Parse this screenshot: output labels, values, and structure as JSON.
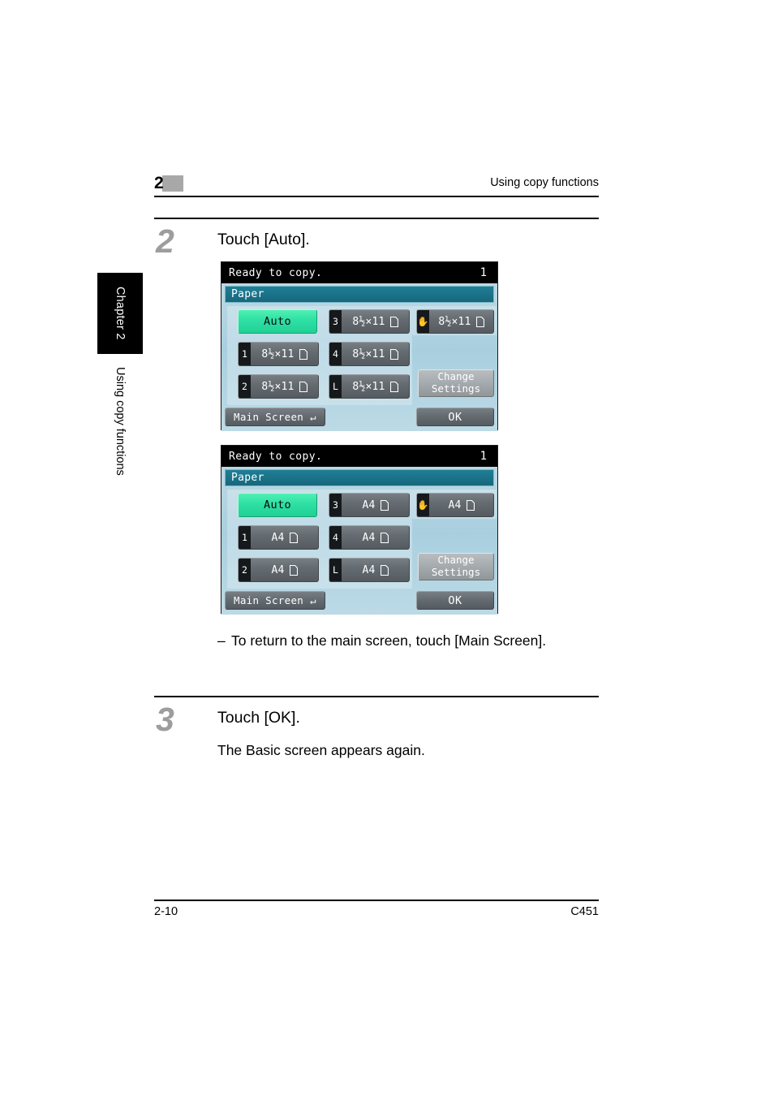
{
  "header": {
    "chapter_number": "2",
    "title": "Using copy functions"
  },
  "sidebar": {
    "tab_label": "Chapter 2",
    "vertical_label": "Using copy functions"
  },
  "steps": [
    {
      "number": "2",
      "title": "Touch [Auto].",
      "note_dash": "–",
      "note": "To return to the main screen, touch [Main Screen]."
    },
    {
      "number": "3",
      "title": "Touch [OK].",
      "body": "The Basic screen appears again."
    }
  ],
  "panels": [
    {
      "status_text": "Ready to copy.",
      "copy_count": "1",
      "title": "Paper",
      "auto_label": "Auto",
      "change_settings_line1": "Change",
      "change_settings_line2": "Settings",
      "main_screen_label": "Main Screen",
      "ok_label": "OK",
      "trays": [
        {
          "badge": "1",
          "size": "8½×11",
          "orientation": "portrait-glyph"
        },
        {
          "badge": "2",
          "size": "8½×11",
          "orientation": "portrait-glyph"
        },
        {
          "badge": "3",
          "size": "8½×11",
          "orientation": "portrait-glyph"
        },
        {
          "badge": "4",
          "size": "8½×11",
          "orientation": "portrait-glyph"
        },
        {
          "badge": "L",
          "size": "8½×11",
          "orientation": "portrait-glyph"
        },
        {
          "badge": "hand-icon",
          "size": "8½×11",
          "orientation": "portrait-glyph"
        }
      ]
    },
    {
      "status_text": "Ready to copy.",
      "copy_count": "1",
      "title": "Paper",
      "auto_label": "Auto",
      "change_settings_line1": "Change",
      "change_settings_line2": "Settings",
      "main_screen_label": "Main Screen",
      "ok_label": "OK",
      "trays": [
        {
          "badge": "1",
          "size": "A4",
          "orientation": "portrait-glyph"
        },
        {
          "badge": "2",
          "size": "A4",
          "orientation": "portrait-glyph"
        },
        {
          "badge": "3",
          "size": "A4",
          "orientation": "portrait-glyph"
        },
        {
          "badge": "4",
          "size": "A4",
          "orientation": "portrait-glyph"
        },
        {
          "badge": "L",
          "size": "A4",
          "orientation": "portrait-glyph"
        },
        {
          "badge": "hand-icon",
          "size": "A4",
          "orientation": "portrait-glyph"
        }
      ]
    }
  ],
  "footer": {
    "page_number": "2-10",
    "model": "C451"
  },
  "colors": {
    "auto_highlight": "#2ee0a3",
    "title_bar": "#1f7f96",
    "panel_bg": "#a9cfdf",
    "button_gray": "#656c71",
    "status_bar": "#000000"
  }
}
